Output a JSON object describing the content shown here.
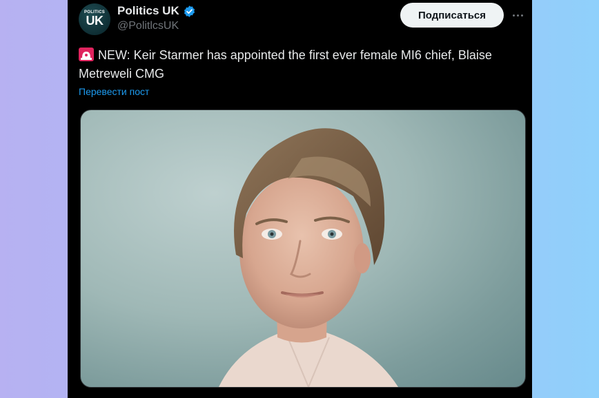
{
  "tweet": {
    "author": {
      "display_name": "Politics UK",
      "handle": "@PolitlcsUK",
      "verified": true,
      "avatar": {
        "small_text": "POLITICS",
        "big_text": "UK"
      }
    },
    "subscribe_label": "Подписаться",
    "more_icon": "more-horizontal-icon",
    "emoji_icon": "police-car-light-icon",
    "text": "NEW: Keir Starmer has appointed the first ever female MI6 chief, Blaise Metreweli CMG",
    "translate_label": "Перевести пост",
    "media": {
      "type": "photo"
    }
  },
  "colors": {
    "background_left": "#b7b1f2",
    "background_right": "#8fd0fb",
    "card": "#000000",
    "primary_text": "#e7e9ea",
    "secondary_text": "#71767b",
    "link": "#1d9bf0",
    "verified": "#1d9bf0",
    "button_bg": "#eff3f4",
    "button_text": "#0f1419"
  }
}
